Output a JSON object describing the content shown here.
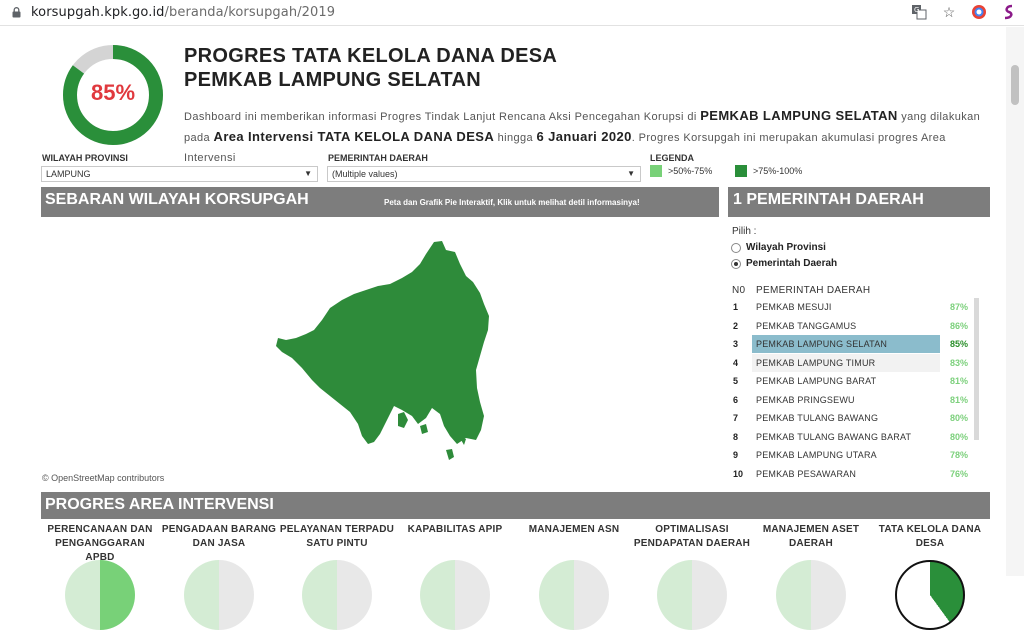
{
  "browser": {
    "url_host": "korsupgah.kpk.go.id",
    "url_path": "/beranda/korsupgah/2019"
  },
  "header": {
    "progress_label": "85%",
    "progress_value": 0.85,
    "title_line1": "PROGRES TATA KELOLA DANA DESA",
    "title_line2": "PEMKAB LAMPUNG SELATAN",
    "desc_part1": "Dashboard ini memberikan informasi Progres Tindak Lanjut Rencana Aksi Pencegahan Korupsi di ",
    "desc_bold1": "PEMKAB LAMPUNG SELATAN",
    "desc_part2": " yang dilakukan pada ",
    "desc_bold2": "Area Intervensi TATA KELOLA DANA DESA",
    "desc_part3": " hingga ",
    "desc_bold3": "6 Januari 2020",
    "desc_part4": ". Progres Korsupgah ini merupakan akumulasi progres Area Intervensi"
  },
  "filters": {
    "wilayah_label": "WILAYAH PROVINSI",
    "wilayah_value": "LAMPUNG",
    "pemda_label": "PEMERINTAH DAERAH",
    "pemda_value": "(Multiple values)",
    "legenda_label": "LEGENDA",
    "legend_low": ">50%-75%",
    "legend_high": ">75%-100%"
  },
  "map_section": {
    "title": "SEBARAN WILAYAH KORSUPGAH",
    "hint": "Peta dan Grafik Pie Interaktif, Klik untuk melihat detil informasinya!",
    "attribution": "© OpenStreetMap contributors"
  },
  "pemda_panel": {
    "title": "1 PEMERINTAH DAERAH",
    "pilih": "Pilih :",
    "radio_provinsi": "Wilayah Provinsi",
    "radio_pemda": "Pemerintah Daerah",
    "col_no": "N0",
    "col_name": "PEMERINTAH DAERAH",
    "rows": [
      {
        "no": "1",
        "name": "PEMKAB MESUJI",
        "pct": "87%"
      },
      {
        "no": "2",
        "name": "PEMKAB TANGGAMUS",
        "pct": "86%"
      },
      {
        "no": "3",
        "name": "PEMKAB LAMPUNG SELATAN",
        "pct": "85%"
      },
      {
        "no": "4",
        "name": "PEMKAB LAMPUNG TIMUR",
        "pct": "83%"
      },
      {
        "no": "5",
        "name": "PEMKAB LAMPUNG BARAT",
        "pct": "81%"
      },
      {
        "no": "6",
        "name": "PEMKAB PRINGSEWU",
        "pct": "81%"
      },
      {
        "no": "7",
        "name": "PEMKAB TULANG BAWANG",
        "pct": "80%"
      },
      {
        "no": "8",
        "name": "PEMKAB TULANG BAWANG BARAT",
        "pct": "80%"
      },
      {
        "no": "9",
        "name": "PEMKAB LAMPUNG UTARA",
        "pct": "78%"
      },
      {
        "no": "10",
        "name": "PEMKAB PESAWARAN",
        "pct": "76%"
      }
    ]
  },
  "area_section": {
    "title": "PROGRES AREA INTERVENSI",
    "categories": [
      {
        "l1": "PERENCANAAN DAN",
        "l2": "PENGANGGARAN APBD"
      },
      {
        "l1": "PENGADAAN BARANG",
        "l2": "DAN JASA"
      },
      {
        "l1": "PELAYANAN TERPADU",
        "l2": "SATU PINTU"
      },
      {
        "l1": "KAPABILITAS APIP",
        "l2": ""
      },
      {
        "l1": "MANAJEMEN ASN",
        "l2": ""
      },
      {
        "l1": "OPTIMALISASI",
        "l2": "PENDAPATAN DAERAH"
      },
      {
        "l1": "MANAJEMEN ASET",
        "l2": "DAERAH"
      },
      {
        "l1": "TATA KELOLA DANA",
        "l2": "DESA"
      }
    ]
  },
  "colors": {
    "green_dark": "#2a8f3a",
    "green_light": "#78d178",
    "header_gray": "#7d7d7d",
    "selected_row": "#8bbccc",
    "percent_red": "#e0393e"
  }
}
